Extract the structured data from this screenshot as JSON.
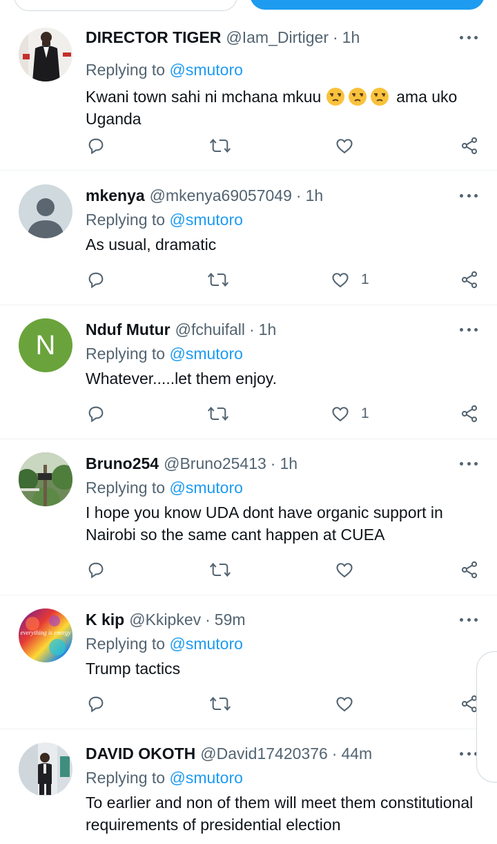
{
  "top_buttons": {
    "left_label": "",
    "right_label": ""
  },
  "reply_prefix": "Replying to",
  "colors": {
    "accent": "#1d9bf0",
    "secondary_text": "#536471",
    "divider": "#eff3f4"
  },
  "tweets": [
    {
      "name": "DIRECTOR TIGER",
      "handle": "@Iam_Dirtiger",
      "time": "1h",
      "replying_to": "@smutoro",
      "text_before_emoji": "Kwani town sahi ni mchana mkuu",
      "emoji": "unamused-face x3",
      "text_after_emoji": "ama uko Uganda",
      "avatar": "photo-man-in-suit",
      "like_count": ""
    },
    {
      "name": "mkenya",
      "handle": "@mkenya69057049",
      "time": "1h",
      "replying_to": "@smutoro",
      "text": "As usual, dramatic",
      "avatar": "default-profile-placeholder",
      "like_count": "1"
    },
    {
      "name": "Nduf Mutur",
      "handle": "@fchuifall",
      "time": "1h",
      "replying_to": "@smutoro",
      "text": "Whatever.....let them enjoy.",
      "avatar": "letter-avatar",
      "avatar_letter": "N",
      "avatar_color": "#6aa33b",
      "like_count": "1"
    },
    {
      "name": "Bruno254",
      "handle": "@Bruno25413",
      "time": "1h",
      "replying_to": "@smutoro",
      "text": "I hope you know UDA dont have organic support in Nairobi so the same cant happen at CUEA",
      "avatar": "photo-signpost-trees",
      "like_count": ""
    },
    {
      "name": "K kip",
      "handle": "@Kkipkev",
      "time": "59m",
      "replying_to": "@smutoro",
      "text": "Trump tactics",
      "avatar": "photo-colorful-energy",
      "avatar_caption": "everything is energy",
      "like_count": ""
    },
    {
      "name": "DAVID OKOTH",
      "handle": "@David17420376",
      "time": "44m",
      "replying_to": "@smutoro",
      "text": "To earlier and non of them will meet them constitutional requirements of presidential election",
      "avatar": "photo-man-standing"
    }
  ]
}
